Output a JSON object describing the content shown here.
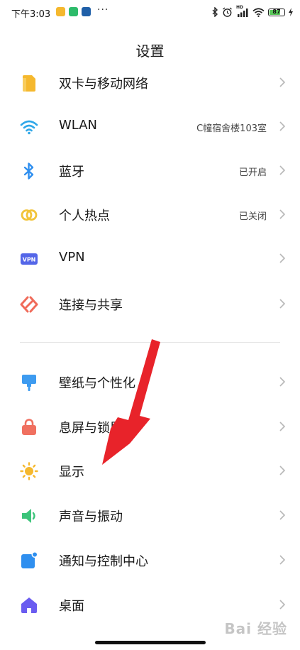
{
  "status_bar": {
    "time": "下午3:03",
    "battery": "87",
    "signal_tag": "HD"
  },
  "page": {
    "title": "设置"
  },
  "settings": [
    {
      "label": "双卡与移动网络",
      "value": "",
      "icon": "sim-card-icon",
      "color": "#F5B82E"
    },
    {
      "label": "WLAN",
      "value": "C幢宿舍楼103室",
      "icon": "wifi-icon",
      "color": "#2FA7E8"
    },
    {
      "label": "蓝牙",
      "value": "已开启",
      "icon": "bluetooth-icon",
      "color": "#2F8FEF"
    },
    {
      "label": "个人热点",
      "value": "已关闭",
      "icon": "hotspot-icon",
      "color": "#F2C43A"
    },
    {
      "label": "VPN",
      "value": "",
      "icon": "vpn-icon",
      "color": "#5466E8",
      "badge": "VPN"
    },
    {
      "label": "连接与共享",
      "value": "",
      "icon": "connection-share-icon",
      "color": "#F06B5A"
    },
    {
      "label": "壁纸与个性化",
      "value": "",
      "icon": "wallpaper-icon",
      "color": "#3D9BF0"
    },
    {
      "label": "息屏与锁屏",
      "value": "",
      "icon": "lock-icon",
      "color": "#F07060"
    },
    {
      "label": "显示",
      "value": "",
      "icon": "sun-icon",
      "color": "#F5B82E"
    },
    {
      "label": "声音与振动",
      "value": "",
      "icon": "speaker-icon",
      "color": "#3CC47A"
    },
    {
      "label": "通知与控制中心",
      "value": "",
      "icon": "notification-icon",
      "color": "#2F8FEF"
    },
    {
      "label": "桌面",
      "value": "",
      "icon": "home-icon",
      "color": "#6A5CF0"
    }
  ],
  "watermark": "Bai 经验",
  "colors": {
    "arrow": "#E8232A",
    "chevron": "#B8B8B8"
  }
}
